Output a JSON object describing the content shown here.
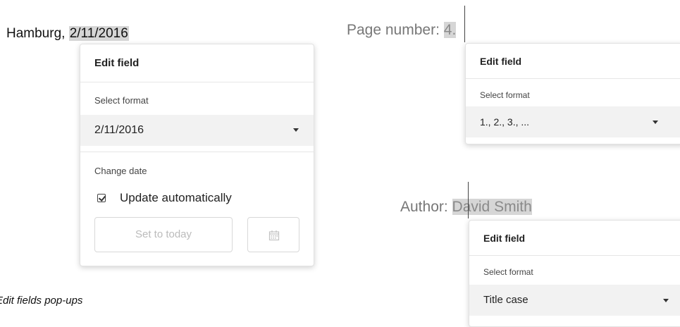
{
  "date_example": {
    "prefix": "Hamburg, ",
    "field_value": "2/11/2016",
    "popup": {
      "title": "Edit field",
      "select_label": "Select format",
      "select_value": "2/11/2016",
      "change_label": "Change date",
      "checkbox_label": "Update automatically",
      "checkbox_checked": true,
      "set_today_label": "Set to today",
      "calendar_icon": "calendar-icon"
    }
  },
  "page_example": {
    "prefix": "Page number: ",
    "field_value": "4.",
    "popup": {
      "title": "Edit field",
      "select_label": "Select format",
      "select_value": "1., 2., 3., ..."
    }
  },
  "author_example": {
    "prefix": "Author: ",
    "field_value": "David Smith",
    "popup": {
      "title": "Edit field",
      "select_label": "Select format",
      "select_value": "Title case"
    }
  },
  "caption": "Edit fields pop-ups"
}
